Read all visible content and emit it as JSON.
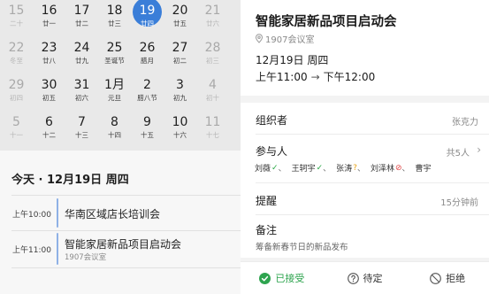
{
  "calendar": {
    "weeks": [
      [
        {
          "num": "15",
          "lunar": "二十",
          "dim": true
        },
        {
          "num": "16",
          "lunar": "廿一",
          "dim": false
        },
        {
          "num": "17",
          "lunar": "廿二",
          "dim": false
        },
        {
          "num": "18",
          "lunar": "廿三",
          "dim": false
        },
        {
          "num": "19",
          "lunar": "廿四",
          "dim": false,
          "today": true
        },
        {
          "num": "20",
          "lunar": "廿五",
          "dim": false
        },
        {
          "num": "21",
          "lunar": "廿六",
          "dim": true
        }
      ],
      [
        {
          "num": "22",
          "lunar": "冬至",
          "dim": true
        },
        {
          "num": "23",
          "lunar": "廿八",
          "dim": false
        },
        {
          "num": "24",
          "lunar": "廿九",
          "dim": false
        },
        {
          "num": "25",
          "lunar": "圣诞节",
          "dim": false
        },
        {
          "num": "26",
          "lunar": "腊月",
          "dim": false
        },
        {
          "num": "27",
          "lunar": "初二",
          "dim": false
        },
        {
          "num": "28",
          "lunar": "初三",
          "dim": true
        }
      ],
      [
        {
          "num": "29",
          "lunar": "初四",
          "dim": true
        },
        {
          "num": "30",
          "lunar": "初五",
          "dim": false
        },
        {
          "num": "31",
          "lunar": "初六",
          "dim": false
        },
        {
          "num": "1月",
          "lunar": "元旦",
          "dim": false
        },
        {
          "num": "2",
          "lunar": "腊八节",
          "dim": false
        },
        {
          "num": "3",
          "lunar": "初九",
          "dim": false
        },
        {
          "num": "4",
          "lunar": "初十",
          "dim": true
        }
      ],
      [
        {
          "num": "5",
          "lunar": "十一",
          "dim": true
        },
        {
          "num": "6",
          "lunar": "十二",
          "dim": false
        },
        {
          "num": "7",
          "lunar": "十三",
          "dim": false
        },
        {
          "num": "8",
          "lunar": "十四",
          "dim": false
        },
        {
          "num": "9",
          "lunar": "十五",
          "dim": false
        },
        {
          "num": "10",
          "lunar": "十六",
          "dim": false
        },
        {
          "num": "11",
          "lunar": "十七",
          "dim": true
        }
      ]
    ]
  },
  "agenda": {
    "title": "今天 · 12月19日 周四",
    "events": [
      {
        "time": "上午10:00",
        "title": "华南区域店长培训会",
        "location": ""
      },
      {
        "time": "上午11:00",
        "title": "智能家居新品项目启动会",
        "location": "1907会议室"
      }
    ]
  },
  "detail": {
    "title": "智能家居新品项目启动会",
    "location": "1907会议室",
    "date": "12月19日 周四",
    "start": "上午11:00",
    "end": "下午12:00",
    "organizer_label": "组织者",
    "organizer": "张克力",
    "attendees_label": "参与人",
    "attendees_count": "共5人",
    "attendees": [
      {
        "name": "刘薇",
        "status": "accepted"
      },
      {
        "name": "王轲宇",
        "status": "accepted"
      },
      {
        "name": "张涛",
        "status": "pending"
      },
      {
        "name": "刘泽林",
        "status": "declined"
      },
      {
        "name": "曹宇",
        "status": "none"
      }
    ],
    "reminder_label": "提醒",
    "reminder": "15分钟前",
    "notes_label": "备注",
    "notes": "筹备新春节日的新品发布"
  },
  "rsvp": {
    "accept": "已接受",
    "tentative": "待定",
    "decline": "拒绝"
  },
  "colors": {
    "today": "#3a7ed8",
    "accepted": "#2ea44f",
    "pending": "#e8a317",
    "declined": "#e04444",
    "event_bar": "#8fb1e6"
  }
}
